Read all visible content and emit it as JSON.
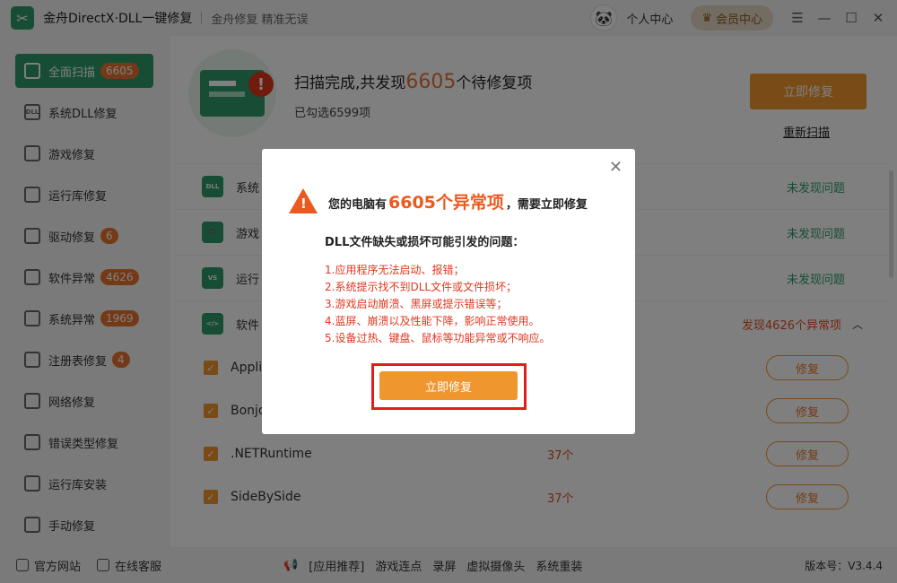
{
  "titlebar": {
    "app_title": "金舟DirectX·DLL一键修复",
    "slogan": "金舟修复 精准无误",
    "personal": "个人中心",
    "vip": "会员中心"
  },
  "sidebar": {
    "items": [
      {
        "label": "全面扫描",
        "badge": "6605",
        "icon": "scan-icon"
      },
      {
        "label": "系统DLL修复",
        "badge": "",
        "icon": "dll-icon"
      },
      {
        "label": "游戏修复",
        "badge": "",
        "icon": "gamepad-icon"
      },
      {
        "label": "运行库修复",
        "badge": "",
        "icon": "vs-icon"
      },
      {
        "label": "驱动修复",
        "badge": "6",
        "icon": "chip-icon"
      },
      {
        "label": "软件异常",
        "badge": "4626",
        "icon": "code-icon"
      },
      {
        "label": "系统异常",
        "badge": "1969",
        "icon": "gear-icon"
      },
      {
        "label": "注册表修复",
        "badge": "4",
        "icon": "registry-icon"
      },
      {
        "label": "网络修复",
        "badge": "",
        "icon": "wifi-icon"
      },
      {
        "label": "错误类型修复",
        "badge": "",
        "icon": "warning-icon"
      },
      {
        "label": "运行库安装",
        "badge": "",
        "icon": "install-icon"
      },
      {
        "label": "手动修复",
        "badge": "",
        "icon": "wrench-icon"
      }
    ]
  },
  "header": {
    "title_prefix": "扫描完成,共发现",
    "title_count": "6605",
    "title_suffix": "个待修复项",
    "selected": "已勾选6599项",
    "fix_now": "立即修复",
    "rescan": "重新扫描"
  },
  "categories": [
    {
      "name": "系统",
      "status": "未发现问题",
      "icon": "DLL"
    },
    {
      "name": "游戏",
      "status": "未发现问题",
      "icon": "G"
    },
    {
      "name": "运行",
      "status": "未发现问题",
      "icon": "VS"
    },
    {
      "name": "软件",
      "status": "发现4626个异常项",
      "icon": "</>"
    }
  ],
  "items": [
    {
      "name": "Appli",
      "count": "",
      "fix": "修复"
    },
    {
      "name": "Bonjo",
      "count": "",
      "fix": "修复"
    },
    {
      "name": ".NETRuntime",
      "count": "37个",
      "fix": "修复"
    },
    {
      "name": "SideBySide",
      "count": "37个",
      "fix": "修复"
    }
  ],
  "dialog": {
    "head_prefix": "您的电脑有",
    "head_count": "6605个异常项",
    "head_suffix": "，需要立即修复",
    "subtitle": "DLL文件缺失或损坏可能引发的问题：",
    "issues": [
      "1.应用程序无法启动、报错；",
      "2.系统提示找不到DLL文件或文件损坏；",
      "3.游戏启动崩溃、黑屏或提示错误等；",
      "4.蓝屏、崩溃以及性能下降，影响正常使用。",
      "5.设备过热、键盘、鼠标等功能异常或不响应。"
    ],
    "fix_button": "立即修复"
  },
  "footer": {
    "official_site": "官方网站",
    "online_service": "在线客服",
    "mid_links": [
      "[应用推荐]",
      "游戏连点",
      "录屏",
      "虚拟摄像头",
      "系统重装"
    ],
    "version": "版本号：V3.4.4"
  },
  "colors": {
    "brand": "#2e9a6b",
    "accent": "#f0962e",
    "danger": "#e2361f"
  }
}
